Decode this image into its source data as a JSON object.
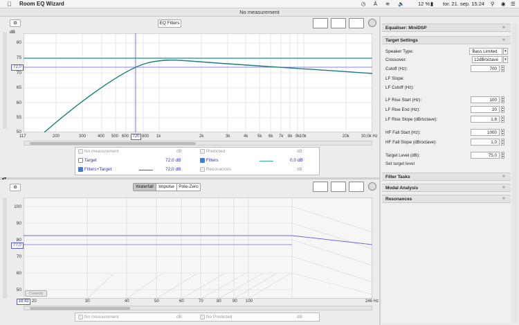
{
  "menubar": {
    "app_name": "Room EQ Wizard",
    "clock": "tor. 21. sep. 15.24",
    "battery": "12 %"
  },
  "window": {
    "title": "No measurement"
  },
  "top_graph": {
    "eq_filters_label": "EQ Filters",
    "y_unit": "dB",
    "y_ticks": [
      "80",
      "75",
      "70",
      "65",
      "60",
      "55",
      "50"
    ],
    "x_ticks": [
      "117",
      "200",
      "300",
      "400",
      "500",
      "600",
      "700",
      "800",
      "1k",
      "2k",
      "3k",
      "4k",
      "5k",
      "6k",
      "7k",
      "8k",
      "9k",
      "10k",
      "20k",
      "30,0k Hz"
    ],
    "cursor_x": "720",
    "cursor_y": "72,0",
    "legend": {
      "r1": {
        "a": "No measurement",
        "a_val": "dB",
        "b": "Predicted",
        "b_val": "dB"
      },
      "r2": {
        "a": "Target",
        "a_val": "72,0 dB",
        "b": "Filters",
        "b_val": "0,0 dB"
      },
      "r3": {
        "a": "Filters+Target",
        "a_val": "72,0 dB",
        "b": "Resonances",
        "b_val": "dB"
      }
    }
  },
  "bottom_graph": {
    "tabs": [
      "Waterfall",
      "Impulse",
      "Pole-Zero"
    ],
    "y_ticks": [
      "100",
      "90",
      "80",
      "70",
      "60",
      "50"
    ],
    "x_ticks": [
      "20",
      "30",
      "40",
      "50",
      "60",
      "70",
      "80",
      "90",
      "100",
      "246 Hz"
    ],
    "cursor_y": "77,0",
    "cursor_x": "18,43",
    "legend": {
      "a": "No measurement",
      "a_val": "dB",
      "b": "No Predicted",
      "b_val": "dB"
    },
    "controls_label": "Controls"
  },
  "right_panel": {
    "equaliser": "Equaliser: MiniDSP",
    "target_settings": "Target Settings",
    "speaker_type_label": "Speaker Type:",
    "speaker_type_value": "Bass Limited",
    "crossover_label": "Crossover:",
    "crossover_value": "12dB/octave",
    "cutoff_label": "Cutoff (Hz):",
    "cutoff_value": "700",
    "lf_slope_label": "LF Slope:",
    "lf_cutoff_label": "LF Cutoff (Hz):",
    "lf_rise_start_label": "LF Rise Start (Hz):",
    "lf_rise_start_value": "100",
    "lf_rise_end_label": "LF Rise End (Hz):",
    "lf_rise_end_value": "20",
    "lf_rise_slope_label": "LF Rise Slope (dB/octave):",
    "lf_rise_slope_value": "1,8",
    "hf_fall_start_label": "HF Fall Start (Hz):",
    "hf_fall_start_value": "1000",
    "hf_fall_slope_label": "HF Fall Slope (dB/octave):",
    "hf_fall_slope_value": "1,0",
    "target_level_label": "Target Level (dB):",
    "target_level_value": "75,0",
    "set_target_label": "Set target level",
    "filter_tasks": "Filter Tasks",
    "modal_analysis": "Modal Analysis",
    "resonances": "Resonances"
  },
  "colors": {
    "target_line": "#3aa6a6",
    "cursor": "#5a5ae0",
    "curve": "#1c7c7c",
    "level_line": "#6b6bd8"
  }
}
